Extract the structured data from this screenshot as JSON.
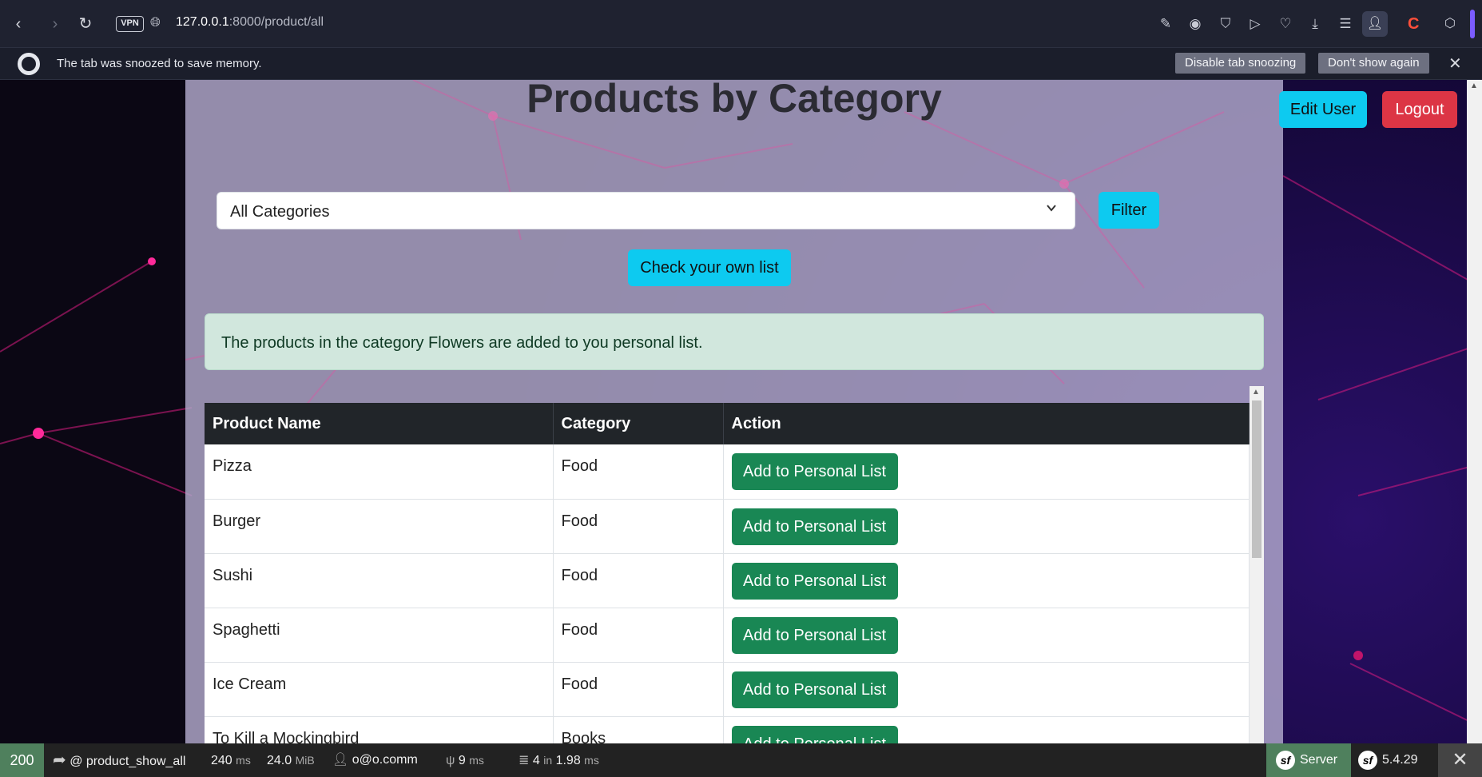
{
  "browser": {
    "vpn_label": "VPN",
    "url_host": "127.0.0.1",
    "url_rest": ":8000/product/all"
  },
  "snooze_bar": {
    "message": "The tab was snoozed to save memory.",
    "disable_label": "Disable tab snoozing",
    "dont_show_label": "Don't show again",
    "close_glyph": "✕"
  },
  "page": {
    "title": "Products by Category",
    "edit_user_label": "Edit User",
    "logout_label": "Logout",
    "category_select_value": "All Categories",
    "filter_label": "Filter",
    "own_list_label": "Check your own list",
    "alert_message": "The products in the category Flowers are added to you personal list."
  },
  "table": {
    "headers": [
      "Product Name",
      "Category",
      "Action"
    ],
    "rows": [
      {
        "name": "Pizza",
        "category": "Food",
        "action": "Add to Personal List"
      },
      {
        "name": "Burger",
        "category": "Food",
        "action": "Add to Personal List"
      },
      {
        "name": "Sushi",
        "category": "Food",
        "action": "Add to Personal List"
      },
      {
        "name": "Spaghetti",
        "category": "Food",
        "action": "Add to Personal List"
      },
      {
        "name": "Ice Cream",
        "category": "Food",
        "action": "Add to Personal List"
      },
      {
        "name": "To Kill a Mockingbird",
        "category": "Books",
        "action": "Add to Personal List"
      }
    ]
  },
  "debug_toolbar": {
    "status_code": "200",
    "route": "@ product_show_all",
    "time_value": "240",
    "time_unit": "ms",
    "memory_value": "24.0",
    "memory_unit": "MiB",
    "user": "o@o.comm",
    "twig_value": "9",
    "twig_unit": "ms",
    "db_queries": "4",
    "db_in": "in",
    "db_time": "1.98",
    "db_unit": "ms",
    "server_label": "Server",
    "symfony_version": "5.4.29",
    "close_glyph": "✕"
  },
  "colors": {
    "info_button": "#0dcaf0",
    "danger_button": "#dc3545",
    "success_button": "#198754",
    "alert_bg": "#d1e7dd",
    "table_header_bg": "#212529",
    "status_ok": "#4f805d"
  },
  "icons": {
    "back": "chevron-left-icon",
    "forward": "chevron-right-icon",
    "reload": "reload-icon",
    "globe": "globe-icon",
    "snapshot": "camera-icon",
    "shield": "shield-icon",
    "play": "play-icon",
    "heart": "heart-icon",
    "download": "download-icon",
    "menu": "menu-icon",
    "profile": "profile-icon",
    "user": "user-icon"
  }
}
